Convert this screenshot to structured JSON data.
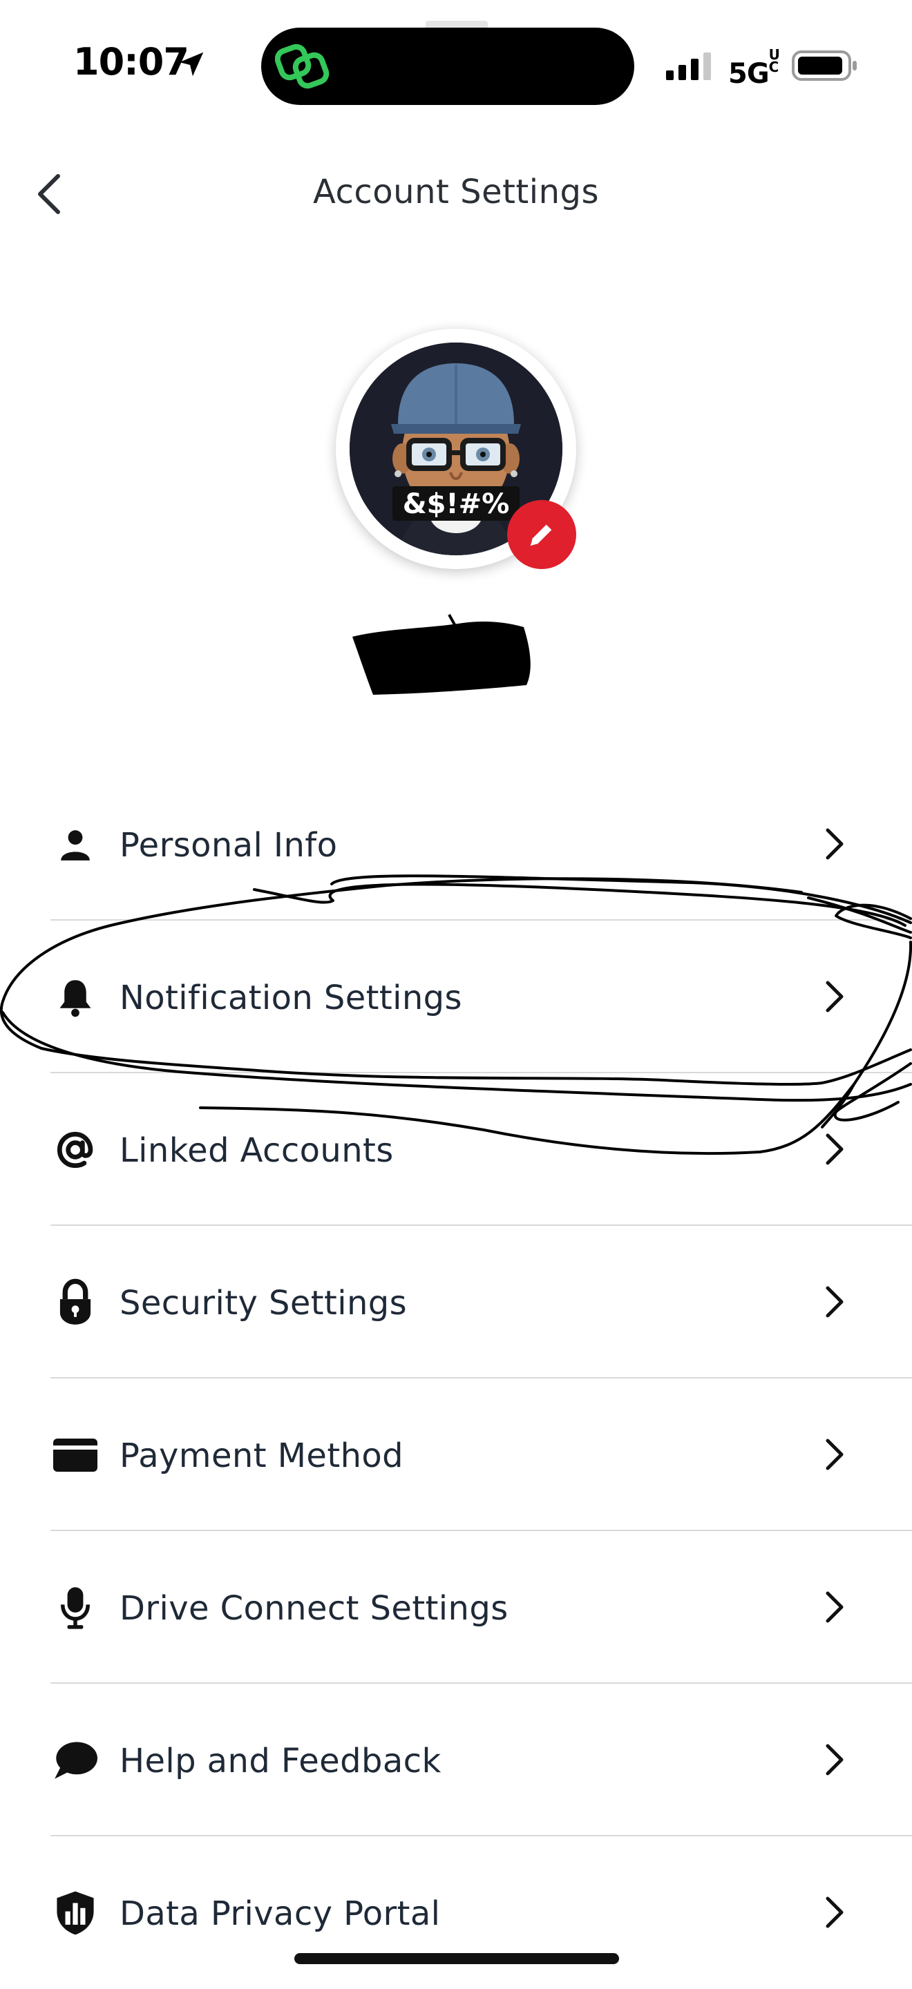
{
  "status_bar": {
    "time": "10:07",
    "network": "5G",
    "network_superscript": "UC"
  },
  "header": {
    "title": "Account Settings"
  },
  "avatar": {
    "caption_text": "&$!#%"
  },
  "menu": {
    "items": [
      {
        "label": "Personal Info",
        "icon": "person-icon"
      },
      {
        "label": "Notification Settings",
        "icon": "bell-icon"
      },
      {
        "label": "Linked Accounts",
        "icon": "at-sign-icon"
      },
      {
        "label": "Security Settings",
        "icon": "lock-icon"
      },
      {
        "label": "Payment Method",
        "icon": "credit-card-icon"
      },
      {
        "label": "Drive Connect Settings",
        "icon": "microphone-icon"
      },
      {
        "label": "Help and Feedback",
        "icon": "chat-bubble-icon"
      },
      {
        "label": "Data Privacy Portal",
        "icon": "shield-chart-icon"
      }
    ]
  },
  "colors": {
    "accent_red": "#e0202d",
    "text_primary": "#1f2937",
    "divider": "#d9d9d9",
    "island_icon_green": "#34c759"
  }
}
